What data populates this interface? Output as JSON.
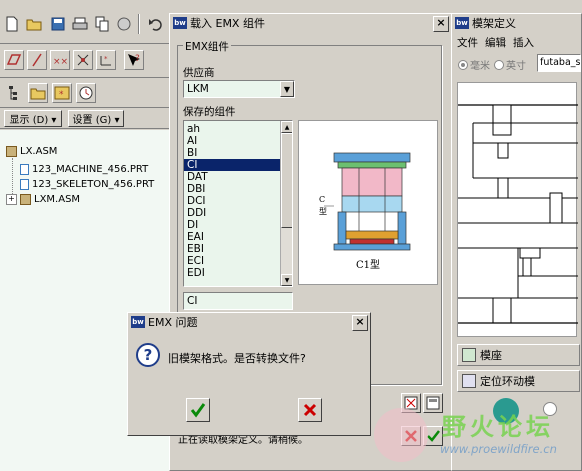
{
  "colors": {
    "selection": "#0a246a",
    "tree_bg": "#f2f8f3",
    "list_bg": "#eaf5ec",
    "accent_green": "#0a8a0a",
    "accent_red": "#cc0000",
    "title_blue": "#1f3d8a"
  },
  "toolbar": {
    "icons": [
      "new-icon",
      "open-icon",
      "save-icon",
      "print-icon",
      "copy-icon",
      "delete-icon",
      "undo-icon"
    ],
    "row2_icons": [
      "datum-plane-icon",
      "datum-axis-icon",
      "datum-point-icon",
      "coord-sys-icon",
      "csys-icon",
      "whats-this-icon"
    ]
  },
  "left_panel": {
    "display_label": "显示 (D) ▾",
    "settings_label": "设置 (G) ▾",
    "tree": [
      {
        "label": "LX.ASM"
      },
      {
        "label": "123_MACHINE_456.PRT"
      },
      {
        "label": "123_SKELETON_456.PRT"
      },
      {
        "label": "LXM.ASM"
      }
    ]
  },
  "load_dialog": {
    "title": "载入 EMX 组件",
    "group_label": "EMX组件",
    "supplier_label": "供应商",
    "supplier_value": "LKM",
    "saved_label": "保存的组件",
    "items": [
      "ah",
      "AI",
      "BI",
      "CI",
      "DAT",
      "DBI",
      "DCI",
      "DDI",
      "DI",
      "EAI",
      "EBI",
      "ECI",
      "EDI"
    ],
    "selected_item": "CI",
    "selected_field": "CI",
    "preview_caption": "C1型",
    "preview_side_label_1": "C",
    "preview_side_label_2": "型",
    "status_text": "正在读取模架定义。请稍候。"
  },
  "mold_dialog": {
    "title": "模架定义",
    "menu": [
      "文件",
      "编辑",
      "插入"
    ],
    "unit_mm": "毫米",
    "unit_inch": "英寸",
    "template_value": "futaba_s",
    "panel_moldbase": "模座",
    "panel_moving": "定位环动模"
  },
  "msg_dialog": {
    "title": "EMX 问题",
    "message": "旧模架格式。是否转换文件?"
  },
  "watermark": {
    "title": "野火论坛",
    "url": "www.proewildfire.cn"
  }
}
